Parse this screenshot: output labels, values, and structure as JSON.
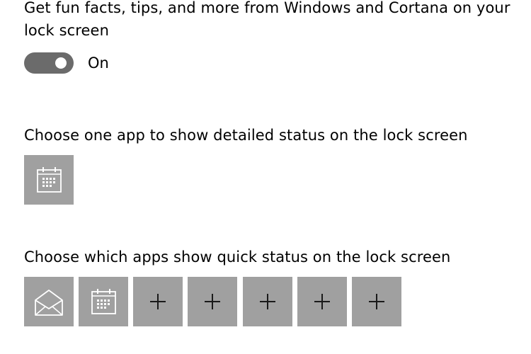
{
  "fun_facts": {
    "line1": "Get fun facts, tips, and more from Windows and Cortana on your",
    "line2": "lock screen",
    "toggle_state": "On",
    "toggle_on": true
  },
  "detailed_status": {
    "heading": "Choose one app to show detailed status on the lock screen",
    "app": {
      "icon": "calendar-icon"
    }
  },
  "quick_status": {
    "heading": "Choose which apps show quick status on the lock screen",
    "apps": [
      {
        "icon": "mail-icon"
      },
      {
        "icon": "calendar-icon"
      },
      {
        "icon": "plus-icon"
      },
      {
        "icon": "plus-icon"
      },
      {
        "icon": "plus-icon"
      },
      {
        "icon": "plus-icon"
      },
      {
        "icon": "plus-icon"
      }
    ]
  },
  "colors": {
    "tile": "#a0a0a0",
    "toggle_track": "#6b6b6b",
    "text": "#000000",
    "background": "#ffffff"
  }
}
